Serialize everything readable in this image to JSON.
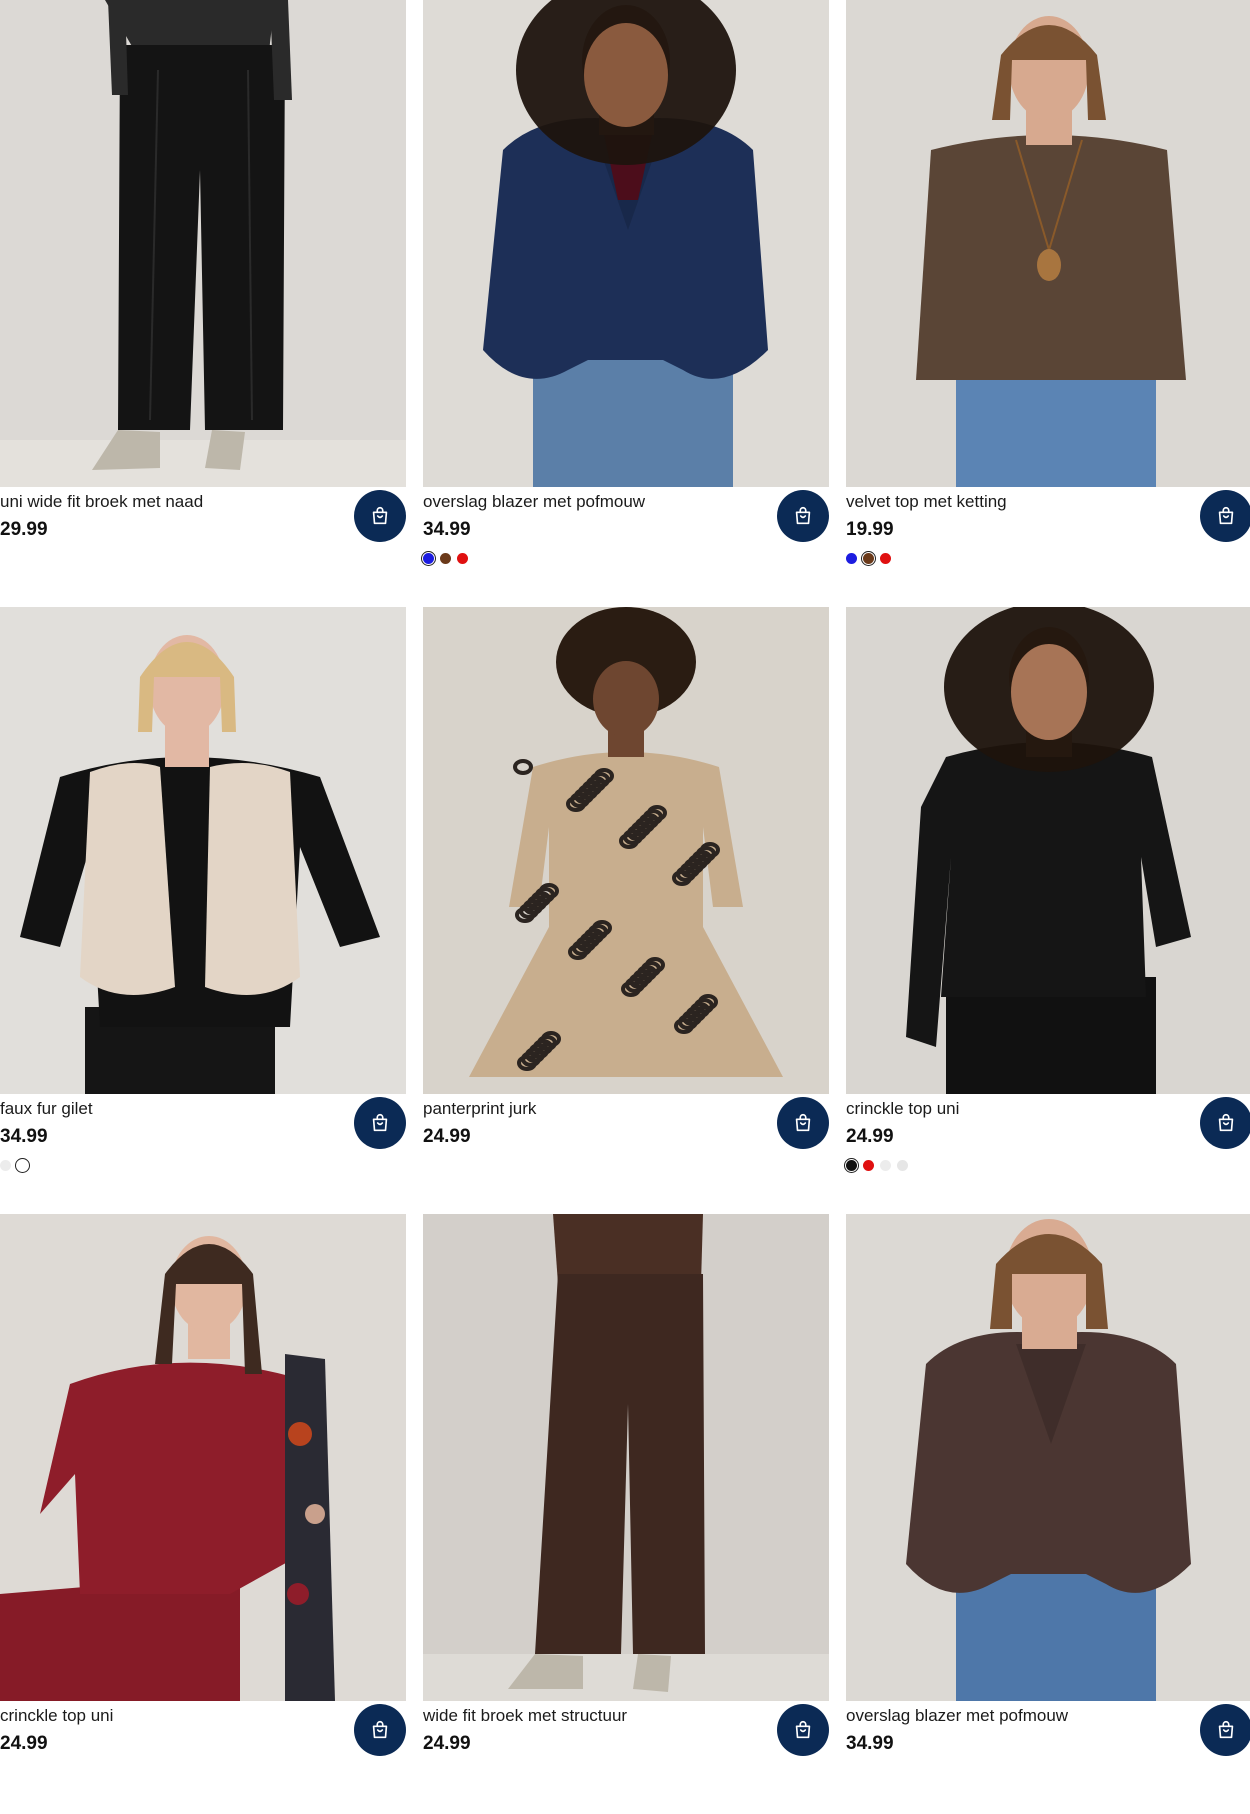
{
  "products": [
    {
      "name": "uni wide fit broek met naad",
      "price": "29.99",
      "photo": {
        "bg": "#dcd9d5",
        "floor": "#e4e1dc",
        "garment": "#141414",
        "top": "#2a2a2a",
        "skin": "#c99a80",
        "hair": "#3b2a20",
        "kind": "trousers-crop"
      },
      "swatches": []
    },
    {
      "name": "overslag blazer met pofmouw",
      "price": "34.99",
      "photo": {
        "bg": "#dedbd6",
        "garment": "#1d2f57",
        "inner": "#5a1020",
        "jeans": "#5b7fa8",
        "skin": "#8a5a3e",
        "hair": "#1e140e",
        "kind": "blazer"
      },
      "swatches": [
        {
          "color": "#1c1ce0",
          "selected": true
        },
        {
          "color": "#6b3a1a",
          "selected": false
        },
        {
          "color": "#e01010",
          "selected": false
        }
      ]
    },
    {
      "name": "velvet top met ketting",
      "price": "19.99",
      "photo": {
        "bg": "#dbd8d3",
        "garment": "#5a4536",
        "jeans": "#5b84b4",
        "skin": "#d7a98f",
        "hair": "#7a5232",
        "kind": "top-necklace"
      },
      "swatches": [
        {
          "color": "#1c1ce0",
          "selected": false
        },
        {
          "color": "#6b3a1a",
          "selected": true
        },
        {
          "color": "#e01010",
          "selected": false
        }
      ]
    },
    {
      "name": "faux fur gilet",
      "price": "34.99",
      "photo": {
        "bg": "#e1dfdb",
        "garment": "#e3d5c6",
        "inner": "#121212",
        "pants": "#151515",
        "skin": "#e2b8a4",
        "hair": "#d9b982",
        "kind": "gilet"
      },
      "swatches": [
        {
          "color": "#ececec",
          "selected": false
        },
        {
          "color": "#ffffff",
          "selected": true
        }
      ]
    },
    {
      "name": "panterprint jurk",
      "price": "24.99",
      "photo": {
        "bg": "#d8d3cb",
        "garment": "#c8ae8e",
        "spots": "#2b2420",
        "skin": "#6e4630",
        "hair": "#2a1c12",
        "kind": "dress"
      },
      "swatches": []
    },
    {
      "name": "crinckle top uni",
      "price": "24.99",
      "photo": {
        "bg": "#d9d6d1",
        "garment": "#151515",
        "pants": "#111111",
        "skin": "#a77456",
        "hair": "#1d130c",
        "kind": "top-black"
      },
      "swatches": [
        {
          "color": "#111111",
          "selected": true
        },
        {
          "color": "#e01010",
          "selected": false
        },
        {
          "color": "#ececec",
          "selected": false
        },
        {
          "color": "#e6e6e6",
          "selected": false
        }
      ]
    },
    {
      "name": "crinckle top uni",
      "price": "24.99",
      "photo": {
        "bg": "#dedad5",
        "garment": "#8e1d2a",
        "pants": "#861b27",
        "scarf": "#2a2a33",
        "skin": "#e1b7a0",
        "hair": "#3e2a20",
        "kind": "top-red"
      },
      "swatches": []
    },
    {
      "name": "wide fit broek met structuur",
      "price": "24.99",
      "photo": {
        "bg": "#d3cfca",
        "garment": "#3e2820",
        "top": "#4a2f24",
        "floor": "#dedbd6",
        "skin": "#c99a80",
        "kind": "trousers-brown"
      },
      "swatches": []
    },
    {
      "name": "overslag blazer met pofmouw",
      "price": "34.99",
      "photo": {
        "bg": "#dcd9d4",
        "garment": "#4b3632",
        "jeans": "#4e77a9",
        "skin": "#d9ab92",
        "hair": "#7a5232",
        "kind": "blazer-brown"
      },
      "swatches": []
    }
  ],
  "icons": {
    "cart": "shopping-bag-icon"
  },
  "colors": {
    "cart_button": "#0b2a55",
    "text": "#1b1b1b"
  }
}
